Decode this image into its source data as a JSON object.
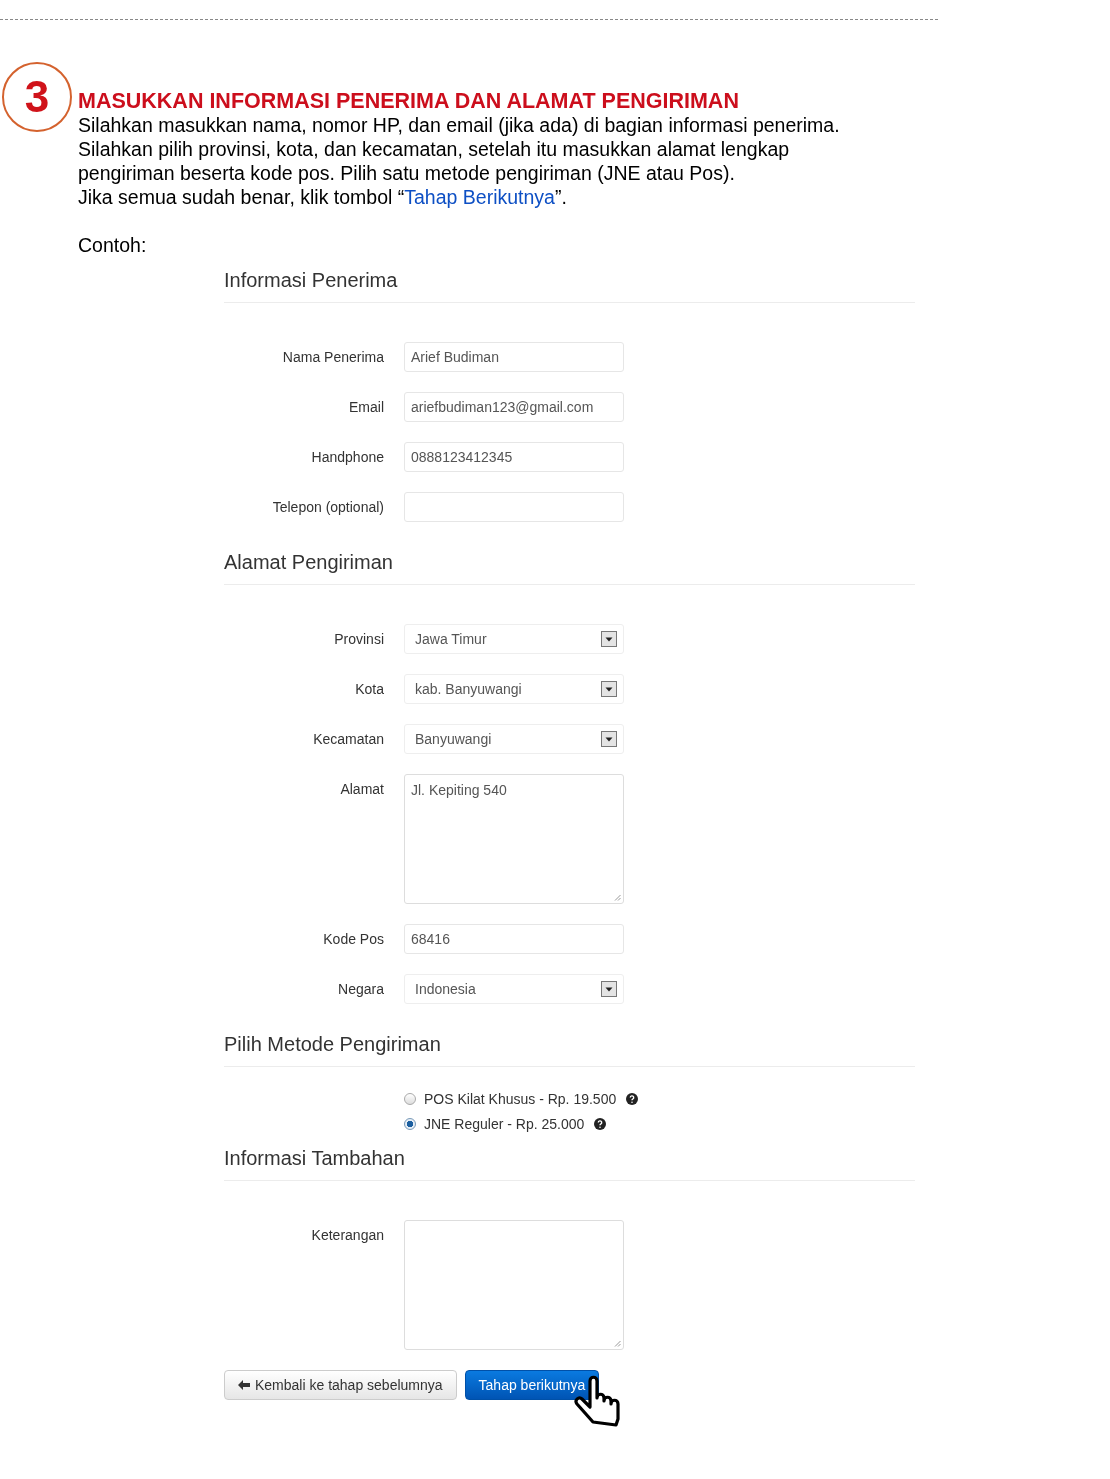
{
  "step": {
    "number": "3",
    "title": "MASUKKAN INFORMASI PENERIMA DAN ALAMAT PENGIRIMAN",
    "lines": [
      "Silahkan masukkan nama, nomor HP, dan email (jika ada) di bagian informasi penerima.",
      "Silahkan pilih provinsi, kota, dan kecamatan, setelah itu masukkan alamat lengkap",
      "pengiriman beserta kode pos. Pilih satu metode pengiriman (JNE atau Pos)."
    ],
    "last_line": {
      "before": "Jika semua sudah benar, klik tombol “",
      "link": "Tahap Berikutnya",
      "after": "”."
    },
    "example_label": "Contoh:"
  },
  "sections": [
    {
      "kind": "fields",
      "title": "Informasi Penerima",
      "fields": [
        {
          "kind": "text",
          "label": "Nama Penerima",
          "value": "Arief Budiman"
        },
        {
          "kind": "text",
          "label": "Email",
          "value": "ariefbudiman123@gmail.com"
        },
        {
          "kind": "text",
          "label": "Handphone",
          "value": "0888123412345"
        },
        {
          "kind": "text",
          "label": "Telepon (optional)"
        }
      ]
    },
    {
      "kind": "fields",
      "title": "Alamat Pengiriman",
      "fields": [
        {
          "kind": "select",
          "label": "Provinsi",
          "value": "Jawa Timur"
        },
        {
          "kind": "select",
          "label": "Kota",
          "value": "kab. Banyuwangi"
        },
        {
          "kind": "select",
          "label": "Kecamatan",
          "value": "Banyuwangi"
        },
        {
          "kind": "textarea",
          "label": "Alamat",
          "value": "Jl. Kepiting 540"
        },
        {
          "kind": "text",
          "label": "Kode Pos",
          "value": "68416"
        },
        {
          "kind": "select",
          "label": "Negara",
          "value": "Indonesia"
        }
      ]
    },
    {
      "kind": "radios",
      "title": "Pilih Metode Pengiriman",
      "options": [
        {
          "label": "POS Kilat Khusus - Rp. 19.500",
          "selected": false
        },
        {
          "label": "JNE Reguler - Rp. 25.000",
          "selected": true
        }
      ]
    },
    {
      "kind": "fields",
      "title": "Informasi Tambahan",
      "fields": [
        {
          "kind": "textarea",
          "label": "Keterangan"
        }
      ]
    }
  ],
  "buttons": {
    "back": "Kembali ke tahap sebelumnya",
    "next": "Tahap berikutnya"
  }
}
